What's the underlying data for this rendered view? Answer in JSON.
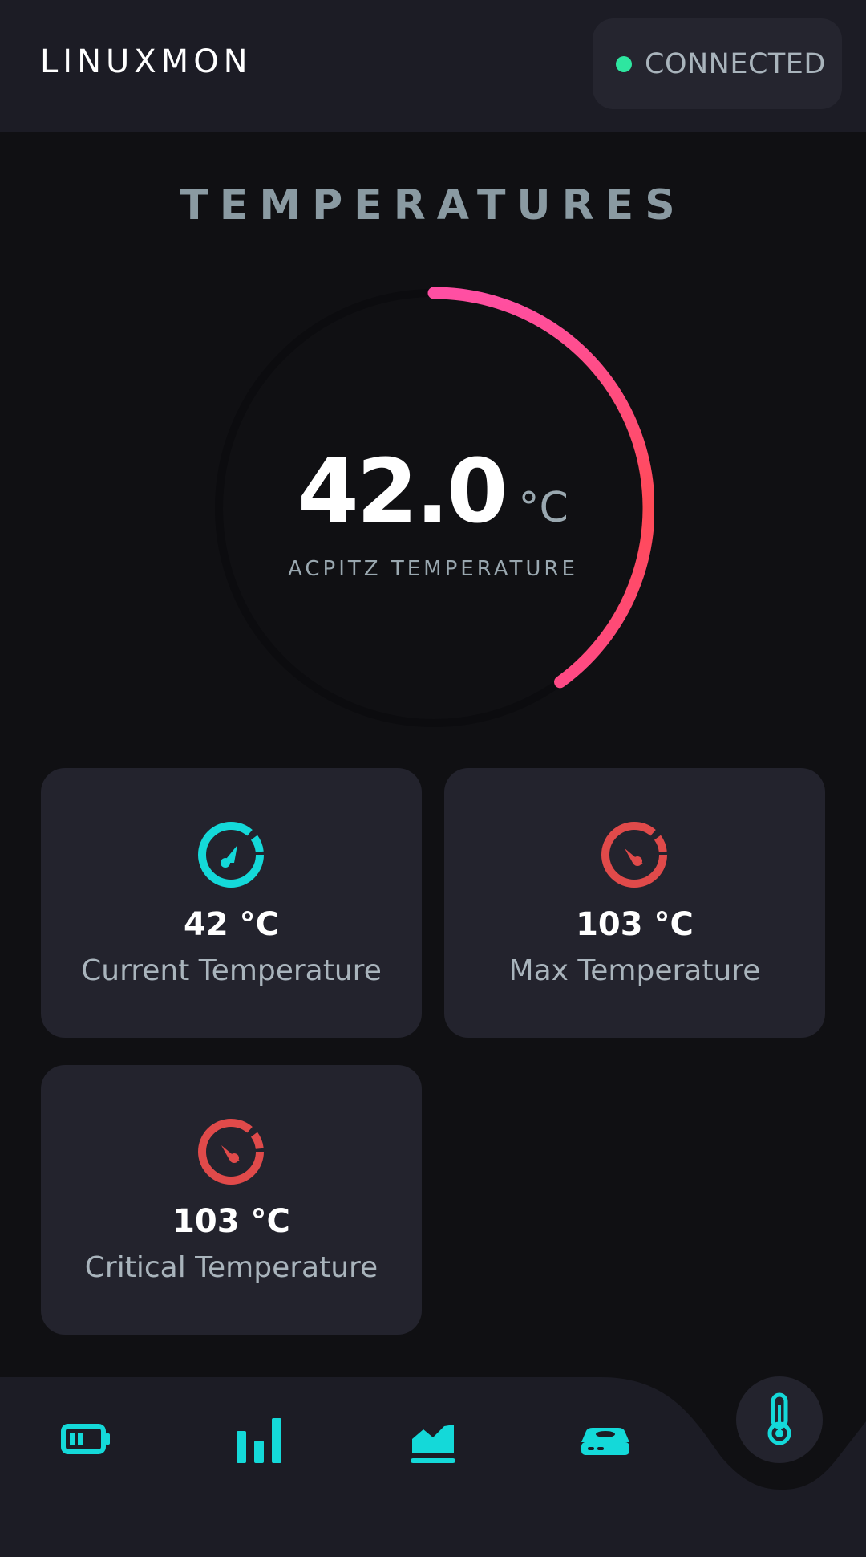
{
  "header": {
    "brand": "LINUXMON",
    "status_label": "CONNECTED",
    "status_color": "#2ee6a0"
  },
  "section": {
    "title": "TEMPERATURES"
  },
  "gauge": {
    "value": "42.0",
    "unit": "°C",
    "label": "ACPITZ TEMPERATURE",
    "fill_fraction": 0.4,
    "gradient": [
      "#ff4fa3",
      "#ff4a55"
    ]
  },
  "cards": [
    {
      "value": "42",
      "unit": "°C",
      "label": "Current Temperature",
      "icon": "speedometer-icon",
      "color": "#14d9d9"
    },
    {
      "value": "103",
      "unit": "°C",
      "label": "Max Temperature",
      "icon": "speedometer-icon",
      "color": "#e04a4a"
    },
    {
      "value": "103",
      "unit": "°C",
      "label": "Critical Temperature",
      "icon": "speedometer-icon",
      "color": "#e04a4a"
    }
  ],
  "nav": {
    "items": [
      "battery-icon",
      "bar-chart-icon",
      "area-chart-icon",
      "disk-drive-icon",
      "thermometer-icon"
    ],
    "active": "thermometer-icon",
    "accent": "#14d9d9"
  }
}
